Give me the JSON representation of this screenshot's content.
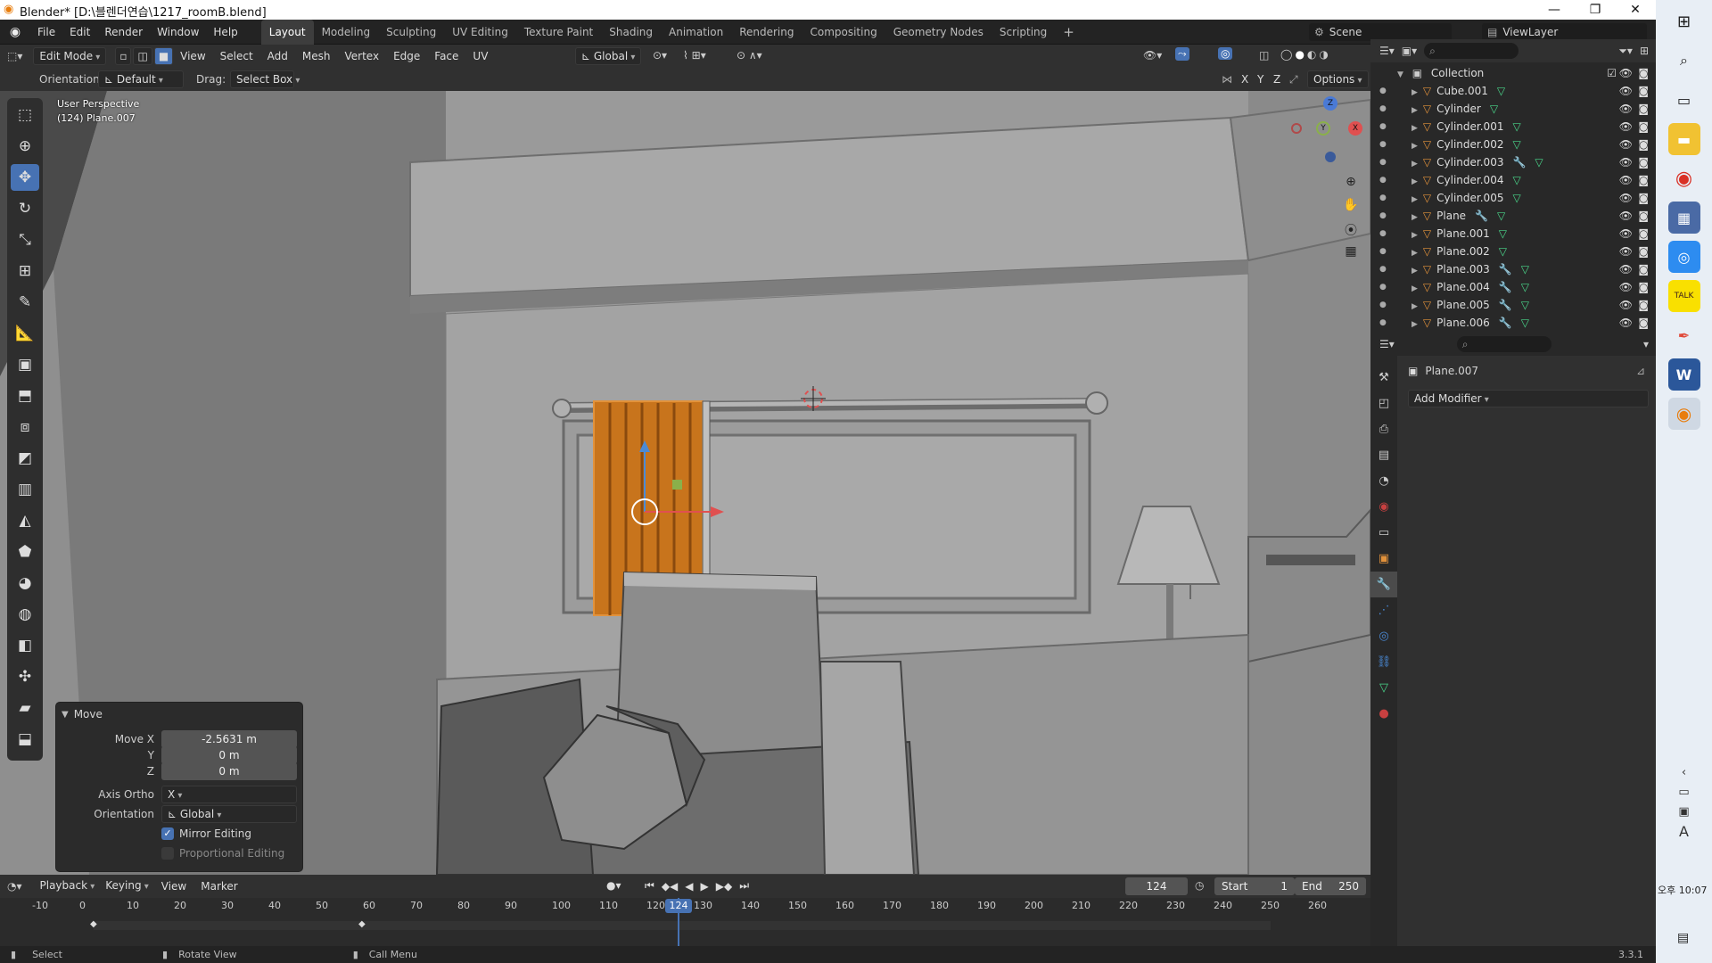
{
  "window": {
    "title": "Blender* [D:\\블렌더연습\\1217_roomB.blend]"
  },
  "menubar": {
    "items": [
      "File",
      "Edit",
      "Render",
      "Window",
      "Help"
    ]
  },
  "workspaces": {
    "tabs": [
      "Layout",
      "Modeling",
      "Sculpting",
      "UV Editing",
      "Texture Paint",
      "Shading",
      "Animation",
      "Rendering",
      "Compositing",
      "Geometry Nodes",
      "Scripting"
    ],
    "active": "Layout",
    "add": "+"
  },
  "scene": {
    "label": "Scene",
    "viewlayer": "ViewLayer"
  },
  "viewport_header": {
    "mode": "Edit Mode",
    "menus": [
      "View",
      "Select",
      "Add",
      "Mesh",
      "Vertex",
      "Edge",
      "Face",
      "UV"
    ],
    "transform": "Global",
    "orientation_label": "Orientation:",
    "orientation": "Default",
    "drag_label": "Drag:",
    "drag": "Select Box",
    "axes": [
      "X",
      "Y",
      "Z"
    ],
    "options": "Options"
  },
  "viewport": {
    "perspective": "User Perspective",
    "object_info": "(124) Plane.007",
    "gizmo": {
      "x": "X",
      "y": "Y",
      "z": "Z"
    }
  },
  "move_panel": {
    "title": "Move",
    "move_x_label": "Move X",
    "move_x": "-2.5631 m",
    "y_label": "Y",
    "y": "0 m",
    "z_label": "Z",
    "z": "0 m",
    "axis_ortho_label": "Axis Ortho",
    "axis_ortho": "X",
    "orientation_label": "Orientation",
    "orientation": "Global",
    "mirror_editing": "Mirror Editing",
    "mirror_checked": true,
    "proportional_editing": "Proportional Editing",
    "proportional_checked": false
  },
  "outliner": {
    "collection": "Collection",
    "items": [
      {
        "name": "Cube.001",
        "modifier": false
      },
      {
        "name": "Cylinder",
        "modifier": false
      },
      {
        "name": "Cylinder.001",
        "modifier": false
      },
      {
        "name": "Cylinder.002",
        "modifier": false
      },
      {
        "name": "Cylinder.003",
        "modifier": true
      },
      {
        "name": "Cylinder.004",
        "modifier": false
      },
      {
        "name": "Cylinder.005",
        "modifier": false
      },
      {
        "name": "Plane",
        "modifier": true
      },
      {
        "name": "Plane.001",
        "modifier": false
      },
      {
        "name": "Plane.002",
        "modifier": false
      },
      {
        "name": "Plane.003",
        "modifier": true
      },
      {
        "name": "Plane.004",
        "modifier": true
      },
      {
        "name": "Plane.005",
        "modifier": true
      },
      {
        "name": "Plane.006",
        "modifier": true
      }
    ]
  },
  "properties": {
    "object": "Plane.007",
    "add_modifier": "Add Modifier"
  },
  "timeline": {
    "menus": [
      "Playback",
      "Keying",
      "View",
      "Marker"
    ],
    "current_frame": "124",
    "start_label": "Start",
    "start": "1",
    "end_label": "End",
    "end": "250",
    "ticks": [
      "-10",
      "0",
      "10",
      "20",
      "30",
      "40",
      "50",
      "60",
      "70",
      "80",
      "90",
      "100",
      "110",
      "120",
      "130",
      "140",
      "150",
      "160",
      "170",
      "180",
      "190",
      "200",
      "210",
      "220",
      "230",
      "240",
      "250",
      "260"
    ]
  },
  "statusbar": {
    "select": "Select",
    "rotate": "Rotate View",
    "call_menu": "Call Menu",
    "version": "3.3.1"
  },
  "taskbar": {
    "time": "오후 10:07",
    "lang": "A"
  },
  "colors": {
    "accent": "#4772b3",
    "object_orange": "#e2923b",
    "curtain": "#c8741c",
    "selected_frame": "#4a8ad6"
  }
}
